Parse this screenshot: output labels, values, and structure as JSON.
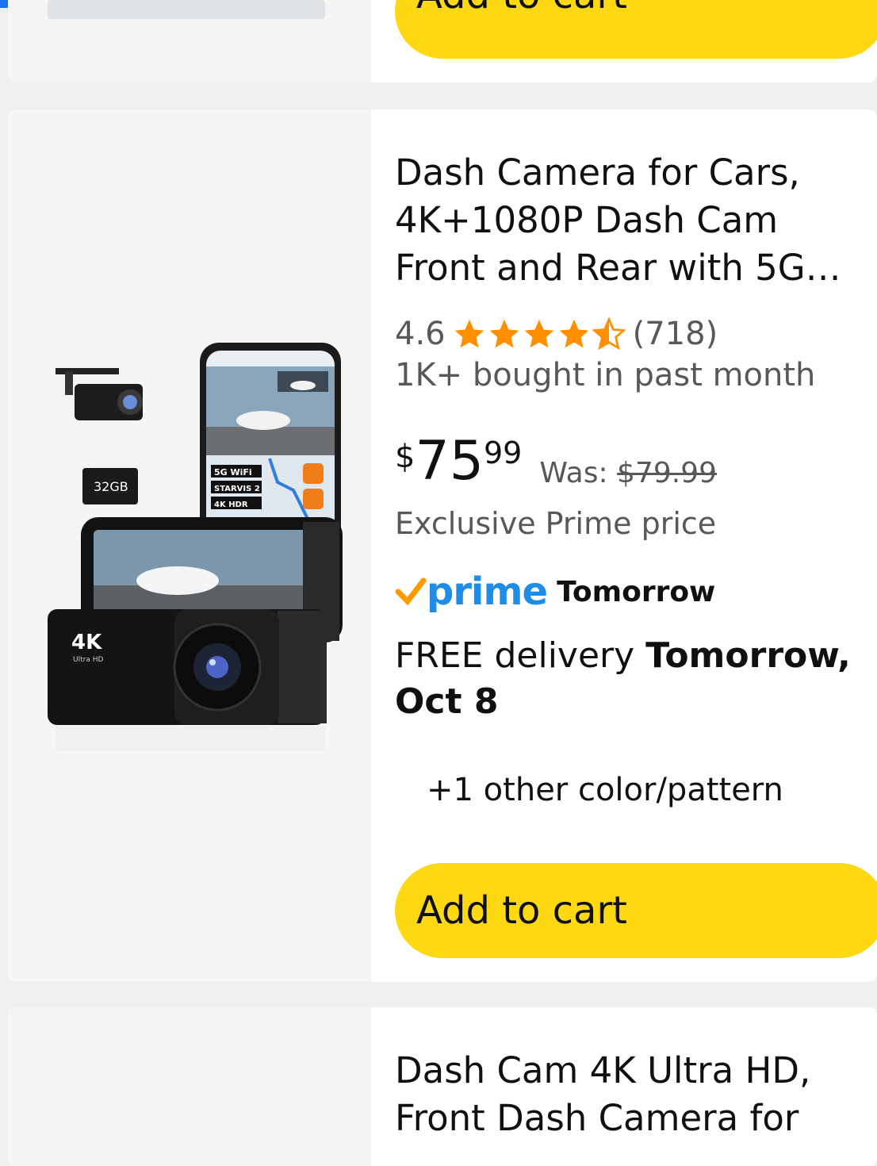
{
  "prev_card": {
    "cart_label": "Add to cart"
  },
  "product": {
    "title": "Dash Camera for Cars, 4K+1080P Dash Cam Front and Rear with 5G…",
    "rating": "4.6",
    "stars": 4.5,
    "review_count": "(718)",
    "bought": "1K+ bought in past month",
    "currency": "$",
    "price_whole": "75",
    "price_fraction": "99",
    "was_label": "Was:",
    "was_price": "$79.99",
    "exclusive": "Exclusive Prime price",
    "prime_label": "prime",
    "prime_when": "Tomorrow",
    "delivery_prefix": "FREE delivery",
    "delivery_date": "Tomorrow, Oct 8",
    "other_colors": "+1 other color/pattern",
    "cart_label": "Add to cart",
    "image_text": {
      "sd_card": "32GB",
      "badge_4k": "4K",
      "badge_uhd": "Ultra HD",
      "feature_5g": "5G WiFi",
      "feature_starvis": "STARVIS 2",
      "feature_hdr": "4K HDR"
    }
  },
  "next_card": {
    "title": "Dash Cam 4K Ultra HD, Front Dash Camera for"
  },
  "colors": {
    "cart_button": "#ffd814",
    "prime_blue": "#1f8ce6",
    "star": "#ff8f00",
    "check": "#ff9900"
  }
}
